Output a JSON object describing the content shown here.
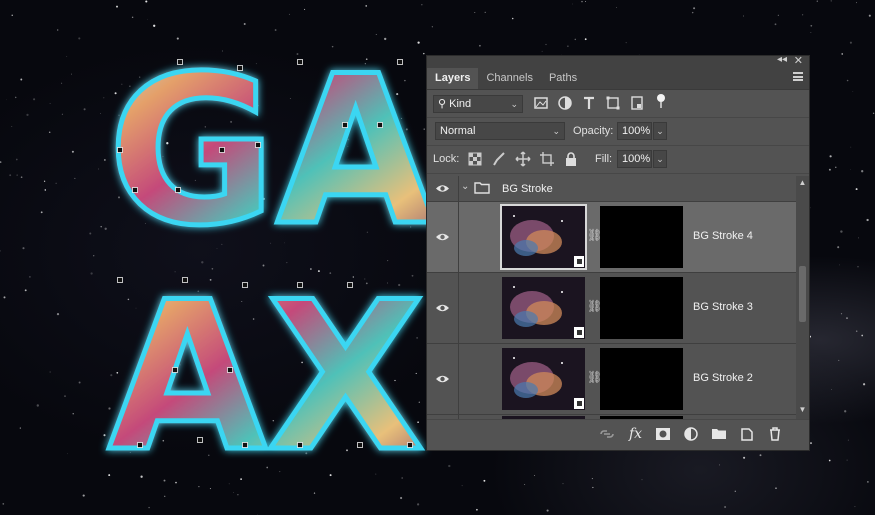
{
  "panel": {
    "tabs": [
      {
        "label": "Layers",
        "active": true
      },
      {
        "label": "Channels",
        "active": false
      },
      {
        "label": "Paths",
        "active": false
      }
    ],
    "filter": {
      "kind_label": "Kind"
    },
    "blend_mode": "Normal",
    "opacity_label": "Opacity:",
    "opacity_value": "100%",
    "lock_label": "Lock:",
    "fill_label": "Fill:",
    "fill_value": "100%",
    "group": {
      "name": "BG Stroke",
      "expanded": true,
      "visible": true
    },
    "layers": [
      {
        "name": "BG Stroke 4",
        "selected": true,
        "visible": true
      },
      {
        "name": "BG Stroke 3",
        "selected": false,
        "visible": true
      },
      {
        "name": "BG Stroke 2",
        "selected": false,
        "visible": true
      }
    ]
  },
  "canvas": {
    "artwork_text_lines": [
      "GA",
      "AX"
    ]
  },
  "colors": {
    "panel_bg": "#535353",
    "selected_row": "#6a6a6a",
    "accent_cyan": "#3ad6f2"
  }
}
